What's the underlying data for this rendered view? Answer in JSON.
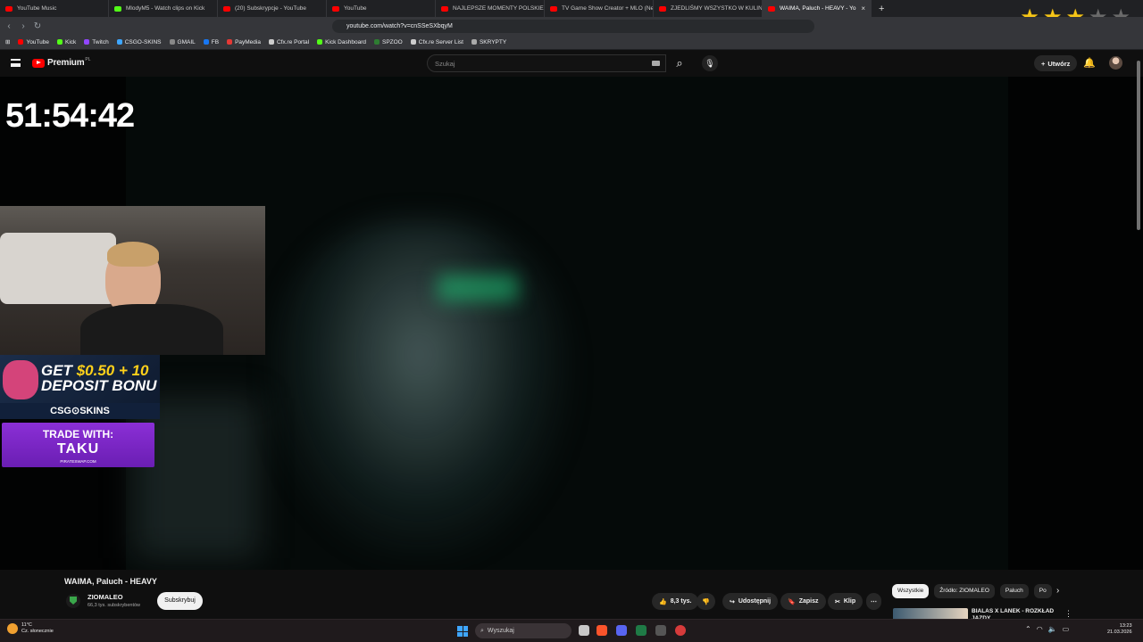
{
  "browser": {
    "tabs": [
      {
        "title": "YouTube Music",
        "color": "#ff0000",
        "active": false
      },
      {
        "title": "MlodyM5 - Watch clips on Kick",
        "color": "#53fc18",
        "active": false
      },
      {
        "title": "(20) Subskrypcje - YouTube",
        "color": "#ff0000",
        "active": false
      },
      {
        "title": "YouTube",
        "color": "#ff0000",
        "active": false
      },
      {
        "title": "NAJLEPSZE MOMENTY POLSKIEGO T",
        "color": "#ff0000",
        "active": false
      },
      {
        "title": "TV Game Show Creator + MLO (New",
        "color": "#ff0000",
        "active": false
      },
      {
        "title": "ZJEDLIŚMY WSZYSTKO W KULINARI",
        "color": "#ff0000",
        "active": false
      },
      {
        "title": "WAIMA, Paluch - HEAVY - Yo",
        "color": "#ff0000",
        "active": true
      }
    ],
    "new_tab": "+",
    "tab_close": "×",
    "url": "youtube.com/watch?v=cnSSeSXbqyM",
    "bookmarks": [
      {
        "label": "YouTube",
        "color": "#ff0000"
      },
      {
        "label": "Kick",
        "color": "#53fc18"
      },
      {
        "label": "Twitch",
        "color": "#9146ff"
      },
      {
        "label": "CSGO-SKINS",
        "color": "#3ea6ff"
      },
      {
        "label": "GMAIL",
        "color": "#888888"
      },
      {
        "label": "FB",
        "color": "#1877f2"
      },
      {
        "label": "PayMedia",
        "color": "#e53935"
      },
      {
        "label": "Cfx.re Portal",
        "color": "#cccccc"
      },
      {
        "label": "Kick Dashboard",
        "color": "#53fc18"
      },
      {
        "label": "SPZOO",
        "color": "#2e7d32"
      },
      {
        "label": "Cfx.re Server List",
        "color": "#cccccc"
      },
      {
        "label": "SKRYPTY",
        "color": "#aaaaaa"
      }
    ],
    "rating_stars": [
      true,
      true,
      true,
      false,
      false
    ]
  },
  "youtube": {
    "logo_text": "Premium",
    "logo_region": "PL",
    "search_placeholder": "Szukaj",
    "create_label": "Utwórz",
    "brand_red": "#ff0000"
  },
  "video": {
    "overlay_timer": "51:54:42",
    "ad1_line1": "GET",
    "ad1_amount": "$0.50 + 10",
    "ad1_line2": "DEPOSIT BONU",
    "ad1_brand": "CSG⊙SKINS",
    "ad2_line1": "TRADE WITH:",
    "ad2_line2": "TAKU",
    "ad2_line3": "PIRATESWAP.COM"
  },
  "info": {
    "title": "WAIMA, Paluch - HEAVY",
    "channel": "ZIOMALEO",
    "subscribers": "66,3 tys. subskrybentów",
    "subscribe_label": "Subskrybuj",
    "likes": "8,3 tys.",
    "share_label": "Udostępnij",
    "save_label": "Zapisz",
    "clip_label": "Klip",
    "more_label": "⋯"
  },
  "sidebar": {
    "chips": [
      "Wszystkie",
      "Źródło: ZIOMALEO",
      "Paluch",
      "Po"
    ],
    "rec_title": "BIALAS X LANEK - ROZKŁAD JAZDY"
  },
  "taskbar": {
    "temp": "11°C",
    "weather": "Cz. słonecznie",
    "search": "Wyszukaj",
    "time": "13:23",
    "date": "21.03.2026"
  }
}
